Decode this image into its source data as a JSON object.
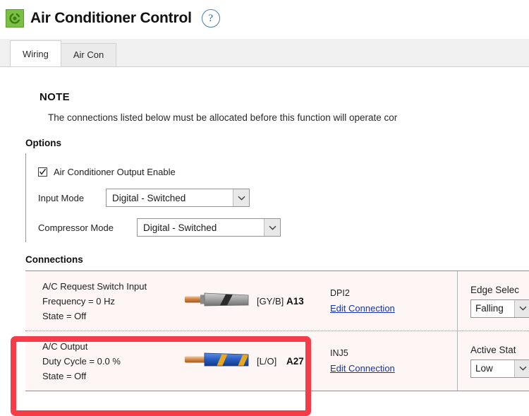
{
  "header": {
    "app_icon": "refresh-circle-icon",
    "title": "Air Conditioner Control",
    "help_label": "?",
    "icon_color": "#7ac143"
  },
  "tabs": [
    {
      "label": "Wiring",
      "active": true
    },
    {
      "label": "Air Con",
      "active": false
    }
  ],
  "note": {
    "heading": "NOTE",
    "text": "The connections listed below must be allocated before this function will operate cor"
  },
  "options": {
    "heading": "Options",
    "enable_checkbox": {
      "label": "Air Conditioner Output Enable",
      "checked": true
    },
    "input_mode": {
      "label": "Input Mode",
      "value": "Digital - Switched"
    },
    "compressor_mode": {
      "label": "Compressor Mode",
      "value": "Digital - Switched"
    }
  },
  "connections": {
    "heading": "Connections",
    "rows": [
      {
        "title": "A/C Request Switch Input",
        "line2": "Frequency  =  0 Hz",
        "line3": "State = Off",
        "wire_code": "[GY/B]",
        "wire_base_color": "#a8a8a8",
        "wire_stripe_color": "#2b2b2b",
        "pin": "A13",
        "connection_name": "DPI2",
        "edit_link": "Edit Connection",
        "param_label": "Edge Selec",
        "param_value": "Falling"
      },
      {
        "title": "A/C Output",
        "line2": "Duty Cycle =   0.0 %",
        "line3": "State = Off",
        "wire_code": "[L/O]",
        "wire_base_color": "#2a5fc4",
        "wire_stripe_color": "#e8a622",
        "pin": "A27",
        "connection_name": "INJ5",
        "edit_link": "Edit Connection",
        "param_label": "Active Stat",
        "param_value": "Low"
      }
    ]
  },
  "annotation": {
    "highlight_color": "#f63c48"
  }
}
